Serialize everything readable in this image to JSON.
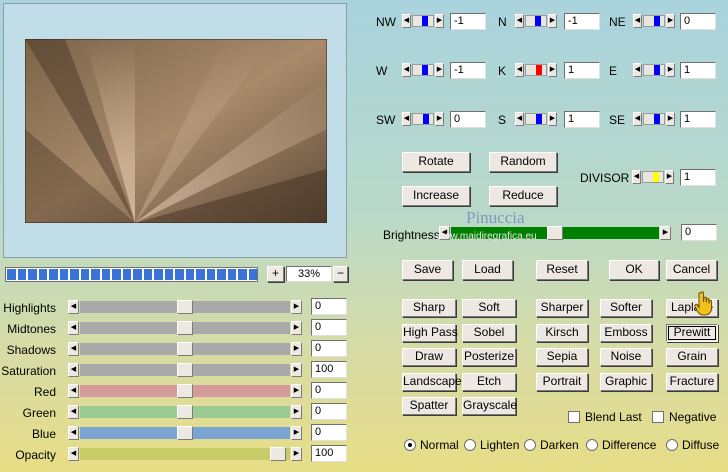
{
  "preview": {
    "pct": "33%",
    "plus": "+",
    "minus": "−"
  },
  "watermark": {
    "name": "Pinuccia",
    "site": "www.maidiregrafica.eu"
  },
  "colors": {
    "blue": "#0000ff",
    "red": "#ff0000",
    "yellow": "#ffff00",
    "green": "#008000"
  },
  "kernel": [
    {
      "label": "NW",
      "value": "-1",
      "level": 0.55,
      "color": "#0000ff"
    },
    {
      "label": "N",
      "value": "-1",
      "level": 0.55,
      "color": "#0000ff"
    },
    {
      "label": "NE",
      "value": "0",
      "level": 0.6,
      "color": "#0000ff"
    },
    {
      "label": "W",
      "value": "-1",
      "level": 0.55,
      "color": "#0000ff"
    },
    {
      "label": "K",
      "value": "1",
      "level": 0.6,
      "color": "#ff0000"
    },
    {
      "label": "E",
      "value": "1",
      "level": 0.6,
      "color": "#0000ff"
    },
    {
      "label": "SW",
      "value": "0",
      "level": 0.6,
      "color": "#0000ff"
    },
    {
      "label": "S",
      "value": "1",
      "level": 0.6,
      "color": "#0000ff"
    },
    {
      "label": "SE",
      "value": "1",
      "level": 0.6,
      "color": "#0000ff"
    }
  ],
  "buttons": {
    "rotate": "Rotate",
    "random": "Random",
    "increase": "Increase",
    "reduce": "Reduce",
    "save": "Save",
    "load": "Load",
    "reset": "Reset",
    "ok": "OK",
    "cancel": "Cancel"
  },
  "divisor": {
    "label": "DIVISOR",
    "value": "1",
    "level": 0.6,
    "color": "#ffff00"
  },
  "brightness": {
    "label": "Brightness",
    "value": "0",
    "level": 0.5
  },
  "adjust": [
    {
      "label": "Highlights",
      "value": "0",
      "level": 0.5,
      "color": "#a9a9a9"
    },
    {
      "label": "Midtones",
      "value": "0",
      "level": 0.5,
      "color": "#a9a9a9"
    },
    {
      "label": "Shadows",
      "value": "0",
      "level": 0.5,
      "color": "#a9a9a9"
    },
    {
      "label": "Saturation",
      "value": "100",
      "level": 0.5,
      "color": "#a9a9a9"
    },
    {
      "label": "Red",
      "value": "0",
      "level": 0.5,
      "color": "#d59b9b"
    },
    {
      "label": "Green",
      "value": "0",
      "level": 0.5,
      "color": "#9bcb92"
    },
    {
      "label": "Blue",
      "value": "0",
      "level": 0.5,
      "color": "#7aa4d1"
    },
    {
      "label": "Opacity",
      "value": "100",
      "level": 0.98,
      "color": "#c9cb68"
    }
  ],
  "presets": [
    [
      "Sharp",
      "Soft",
      "Sharper",
      "Softer",
      "Laplace"
    ],
    [
      "High Pass",
      "Sobel",
      "Kirsch",
      "Emboss",
      "Prewitt"
    ],
    [
      "Draw",
      "Posterize",
      "Sepia",
      "Noise",
      "Grain"
    ],
    [
      "Landscape",
      "Etch",
      "Portrait",
      "Graphic",
      "Fracture"
    ],
    [
      "Spatter",
      "Grayscale"
    ]
  ],
  "selected_preset": "Prewitt",
  "checks": [
    {
      "label": "Blend Last",
      "checked": false
    },
    {
      "label": "Negative",
      "checked": false
    }
  ],
  "modes": [
    {
      "label": "Normal",
      "selected": true
    },
    {
      "label": "Lighten",
      "selected": false
    },
    {
      "label": "Darken",
      "selected": false
    },
    {
      "label": "Difference",
      "selected": false
    },
    {
      "label": "Diffuse",
      "selected": false
    }
  ]
}
